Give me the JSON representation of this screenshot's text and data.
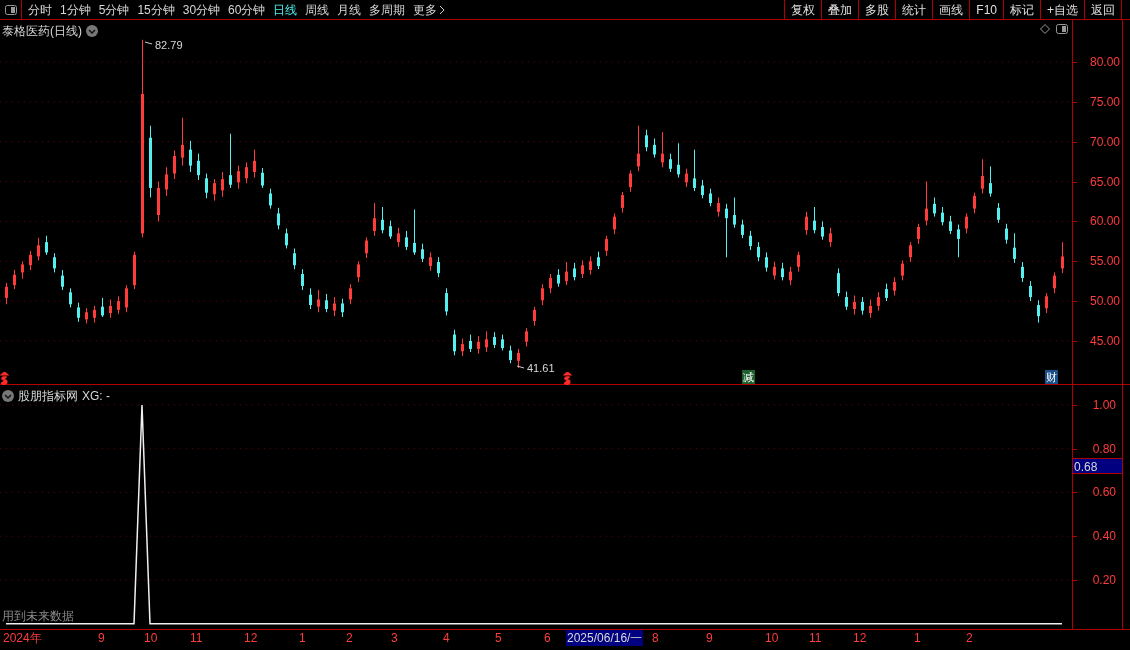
{
  "toolbar": {
    "periods": [
      {
        "label": "分时",
        "selected": false
      },
      {
        "label": "1分钟",
        "selected": false
      },
      {
        "label": "5分钟",
        "selected": false
      },
      {
        "label": "15分钟",
        "selected": false
      },
      {
        "label": "30分钟",
        "selected": false
      },
      {
        "label": "60分钟",
        "selected": false
      },
      {
        "label": "日线",
        "selected": true
      },
      {
        "label": "周线",
        "selected": false
      },
      {
        "label": "月线",
        "selected": false
      },
      {
        "label": "多周期",
        "selected": false
      },
      {
        "label": "更多",
        "selected": false
      }
    ],
    "buttons": [
      "复权",
      "叠加",
      "多股",
      "统计",
      "画线",
      "F10",
      "标记",
      "+自选",
      "返回"
    ]
  },
  "price_chart": {
    "title": "泰格医药(日线)",
    "high_label": "82.79",
    "low_label": "41.61",
    "chart_data": {
      "type": "candlestick",
      "ohlc": [
        [
          50.4,
          52.3,
          49.6,
          51.8
        ],
        [
          52.0,
          53.9,
          51.5,
          53.3
        ],
        [
          53.6,
          55.0,
          52.8,
          54.6
        ],
        [
          54.5,
          56.3,
          53.9,
          55.8
        ],
        [
          55.6,
          57.9,
          55.1,
          57.0
        ],
        [
          57.4,
          58.2,
          55.8,
          56.1
        ],
        [
          55.5,
          56.0,
          53.6,
          54.1
        ],
        [
          53.2,
          53.9,
          51.4,
          51.8
        ],
        [
          51.1,
          51.6,
          49.2,
          49.6
        ],
        [
          49.2,
          49.8,
          47.4,
          47.9
        ],
        [
          47.7,
          49.1,
          47.2,
          48.6
        ],
        [
          47.9,
          49.4,
          47.3,
          48.9
        ],
        [
          49.3,
          50.4,
          48.0,
          48.2
        ],
        [
          48.5,
          50.2,
          47.9,
          49.4
        ],
        [
          48.9,
          50.6,
          48.4,
          50.0
        ],
        [
          49.2,
          52.0,
          48.6,
          51.6
        ],
        [
          52.0,
          56.2,
          51.5,
          55.8
        ],
        [
          58.5,
          82.79,
          58.0,
          76.0
        ],
        [
          70.5,
          72.0,
          63.0,
          64.2
        ],
        [
          60.8,
          65.0,
          60.0,
          64.2
        ],
        [
          64.0,
          66.8,
          63.2,
          65.9
        ],
        [
          66.0,
          68.9,
          65.3,
          68.2
        ],
        [
          68.0,
          73.0,
          67.0,
          69.6
        ],
        [
          69.0,
          70.1,
          66.2,
          67.0
        ],
        [
          67.6,
          68.5,
          65.2,
          65.8
        ],
        [
          65.4,
          66.0,
          62.9,
          63.6
        ],
        [
          63.4,
          65.3,
          62.6,
          64.8
        ],
        [
          63.9,
          66.2,
          63.1,
          65.3
        ],
        [
          65.8,
          71.0,
          64.2,
          64.6
        ],
        [
          64.9,
          67.0,
          64.1,
          66.3
        ],
        [
          65.4,
          67.4,
          64.8,
          66.8
        ],
        [
          66.2,
          69.0,
          65.5,
          67.6
        ],
        [
          66.1,
          66.7,
          64.2,
          64.5
        ],
        [
          63.5,
          64.1,
          61.6,
          62.0
        ],
        [
          61.0,
          61.7,
          59.0,
          59.5
        ],
        [
          58.5,
          59.1,
          56.6,
          57.0
        ],
        [
          56.0,
          56.6,
          54.0,
          54.5
        ],
        [
          53.4,
          54.0,
          51.4,
          51.9
        ],
        [
          50.8,
          51.6,
          49.0,
          49.5
        ],
        [
          49.3,
          51.4,
          48.6,
          50.2
        ],
        [
          50.1,
          50.9,
          48.6,
          49.0
        ],
        [
          48.8,
          50.5,
          48.1,
          49.7
        ],
        [
          49.7,
          50.3,
          48.0,
          48.6
        ],
        [
          50.2,
          52.1,
          49.6,
          51.6
        ],
        [
          53.0,
          55.0,
          52.4,
          54.6
        ],
        [
          56.0,
          58.0,
          55.4,
          57.6
        ],
        [
          58.8,
          62.3,
          58.2,
          60.4
        ],
        [
          60.2,
          61.8,
          58.5,
          58.9
        ],
        [
          59.4,
          60.1,
          57.8,
          58.1
        ],
        [
          57.4,
          59.2,
          56.8,
          58.5
        ],
        [
          58.0,
          58.8,
          56.4,
          56.8
        ],
        [
          57.3,
          61.5,
          55.8,
          56.1
        ],
        [
          56.5,
          57.2,
          54.9,
          55.3
        ],
        [
          54.4,
          56.1,
          53.8,
          55.5
        ],
        [
          54.9,
          55.5,
          53.0,
          53.5
        ],
        [
          51.0,
          51.6,
          48.2,
          48.7
        ],
        [
          45.8,
          46.4,
          43.2,
          43.7
        ],
        [
          43.7,
          45.3,
          43.1,
          44.6
        ],
        [
          45.0,
          45.8,
          43.6,
          44.0
        ],
        [
          44.0,
          45.6,
          43.4,
          44.9
        ],
        [
          44.2,
          46.2,
          43.6,
          45.2
        ],
        [
          45.5,
          46.1,
          44.1,
          44.5
        ],
        [
          45.2,
          45.8,
          43.8,
          44.1
        ],
        [
          43.8,
          44.4,
          42.2,
          42.6
        ],
        [
          42.5,
          44.0,
          41.61,
          43.5
        ],
        [
          44.9,
          46.6,
          44.3,
          46.2
        ],
        [
          47.5,
          49.3,
          46.9,
          48.9
        ],
        [
          50.1,
          52.1,
          49.5,
          51.6
        ],
        [
          51.6,
          53.4,
          51.0,
          52.9
        ],
        [
          53.3,
          54.0,
          51.8,
          52.2
        ],
        [
          52.5,
          54.9,
          52.0,
          53.7
        ],
        [
          54.1,
          54.8,
          52.6,
          53.0
        ],
        [
          53.4,
          55.1,
          52.9,
          54.5
        ],
        [
          53.9,
          55.6,
          53.3,
          55.0
        ],
        [
          55.5,
          56.2,
          54.0,
          54.4
        ],
        [
          56.3,
          58.2,
          55.7,
          57.8
        ],
        [
          59.0,
          61.0,
          58.4,
          60.6
        ],
        [
          61.7,
          63.7,
          61.1,
          63.3
        ],
        [
          64.3,
          66.4,
          63.7,
          66.0
        ],
        [
          66.9,
          72.0,
          66.3,
          68.5
        ],
        [
          70.8,
          71.5,
          68.8,
          69.3
        ],
        [
          69.6,
          70.4,
          68.0,
          68.4
        ],
        [
          67.4,
          71.2,
          66.8,
          68.5
        ],
        [
          67.8,
          68.5,
          66.2,
          66.6
        ],
        [
          67.1,
          69.8,
          65.5,
          65.9
        ],
        [
          64.9,
          66.6,
          64.3,
          66.0
        ],
        [
          65.4,
          69.0,
          63.8,
          64.2
        ],
        [
          64.5,
          65.2,
          62.9,
          63.3
        ],
        [
          63.5,
          64.1,
          61.9,
          62.3
        ],
        [
          61.2,
          63.0,
          60.6,
          62.3
        ],
        [
          61.6,
          62.2,
          55.5,
          60.4
        ],
        [
          60.8,
          63.0,
          59.2,
          59.6
        ],
        [
          59.6,
          60.2,
          57.9,
          58.3
        ],
        [
          58.2,
          58.8,
          56.4,
          56.9
        ],
        [
          56.8,
          57.4,
          55.0,
          55.5
        ],
        [
          55.5,
          56.1,
          53.7,
          54.2
        ],
        [
          53.2,
          54.9,
          52.7,
          54.3
        ],
        [
          54.1,
          54.8,
          52.6,
          53.0
        ],
        [
          52.6,
          54.3,
          52.0,
          53.7
        ],
        [
          54.3,
          56.2,
          53.7,
          55.8
        ],
        [
          58.9,
          61.2,
          58.3,
          60.6
        ],
        [
          60.1,
          61.8,
          58.5,
          58.9
        ],
        [
          59.3,
          60.0,
          57.7,
          58.1
        ],
        [
          57.4,
          59.2,
          56.8,
          58.5
        ],
        [
          53.5,
          54.1,
          50.6,
          51.0
        ],
        [
          50.5,
          51.2,
          48.9,
          49.3
        ],
        [
          49.0,
          50.7,
          48.3,
          49.9
        ],
        [
          49.9,
          50.5,
          48.3,
          48.8
        ],
        [
          48.5,
          50.2,
          47.9,
          49.4
        ],
        [
          49.4,
          51.1,
          48.8,
          50.5
        ],
        [
          51.5,
          52.2,
          50.0,
          50.4
        ],
        [
          51.3,
          53.0,
          50.7,
          52.4
        ],
        [
          53.2,
          55.1,
          52.6,
          54.7
        ],
        [
          55.5,
          57.4,
          54.9,
          57.0
        ],
        [
          57.8,
          59.7,
          57.2,
          59.3
        ],
        [
          60.1,
          65.0,
          59.5,
          61.6
        ],
        [
          62.2,
          63.0,
          60.6,
          61.0
        ],
        [
          61.1,
          61.8,
          59.5,
          59.9
        ],
        [
          60.0,
          60.7,
          58.4,
          58.8
        ],
        [
          59.0,
          59.6,
          55.5,
          57.8
        ],
        [
          59.1,
          61.0,
          58.5,
          60.6
        ],
        [
          61.6,
          63.6,
          61.0,
          63.2
        ],
        [
          64.1,
          67.8,
          63.5,
          65.7
        ],
        [
          64.8,
          66.9,
          63.1,
          63.5
        ],
        [
          61.7,
          62.3,
          59.8,
          60.2
        ],
        [
          59.1,
          59.7,
          57.2,
          57.7
        ],
        [
          56.7,
          58.5,
          54.8,
          55.3
        ],
        [
          54.3,
          54.9,
          52.4,
          52.9
        ],
        [
          51.9,
          52.5,
          50.0,
          50.5
        ],
        [
          49.5,
          50.1,
          47.3,
          48.1
        ],
        [
          49.1,
          51.0,
          48.5,
          50.6
        ],
        [
          51.6,
          53.6,
          51.0,
          53.2
        ],
        [
          54.1,
          57.4,
          53.5,
          55.6
        ]
      ],
      "ylim": [
        39.47,
        85.27
      ],
      "grid": true,
      "yticks": [
        {
          "value": 80,
          "label": "80.00"
        },
        {
          "value": 75,
          "label": "75.00"
        },
        {
          "value": 70,
          "label": "70.00"
        },
        {
          "value": 65,
          "label": "65.00"
        },
        {
          "value": 60,
          "label": "60.00"
        },
        {
          "value": 55,
          "label": "55.00"
        },
        {
          "value": 50,
          "label": "50.00"
        },
        {
          "value": 45,
          "label": "45.00"
        }
      ]
    },
    "event_badges": [
      {
        "label": "减",
        "color": "#1d5f2e"
      },
      {
        "label": "财",
        "color": "#1b4f8a"
      }
    ]
  },
  "indicator": {
    "title": "股朋指标网",
    "value_label": "XG: -",
    "chart_data": {
      "type": "line",
      "ylim": [
        -0.024,
        1.091
      ],
      "grid": true,
      "yticks": [
        {
          "value": 1,
          "label": "1.00"
        },
        {
          "value": 0.8,
          "label": "0.80"
        },
        {
          "value": 0.6,
          "label": "0.60"
        },
        {
          "value": 0.4,
          "label": "0.40"
        },
        {
          "value": 0.2,
          "label": "0.20"
        }
      ],
      "series": [
        {
          "values": [
            0,
            0,
            0,
            0,
            0,
            0,
            0,
            0,
            0,
            0,
            0,
            0,
            0,
            0,
            0,
            0,
            0,
            1,
            0,
            0,
            0,
            0,
            0,
            0,
            0,
            0,
            0,
            0,
            0,
            0,
            0,
            0,
            0,
            0,
            0,
            0,
            0,
            0,
            0,
            0,
            0,
            0,
            0,
            0,
            0,
            0,
            0,
            0,
            0,
            0,
            0,
            0,
            0,
            0,
            0,
            0,
            0,
            0,
            0,
            0,
            0,
            0,
            0,
            0,
            0,
            0,
            0,
            0,
            0,
            0,
            0,
            0,
            0,
            0,
            0,
            0,
            0,
            0,
            0,
            0,
            0,
            0,
            0,
            0,
            0,
            0,
            0,
            0,
            0,
            0,
            0,
            0,
            0,
            0,
            0,
            0,
            0,
            0,
            0,
            0,
            0,
            0,
            0,
            0,
            0,
            0,
            0,
            0,
            0,
            0,
            0,
            0,
            0,
            0,
            0,
            0,
            0,
            0,
            0,
            0,
            0,
            0,
            0,
            0,
            0,
            0,
            0,
            0,
            0,
            0,
            0,
            0,
            0
          ]
        }
      ]
    },
    "current_value": "0.68",
    "warning": "用到未来数据"
  },
  "time_axis": {
    "labels": [
      {
        "label": "2024年",
        "selected": false
      },
      {
        "label": "9",
        "selected": false
      },
      {
        "label": "10",
        "selected": false
      },
      {
        "label": "11",
        "selected": false
      },
      {
        "label": "12",
        "selected": false
      },
      {
        "label": "1",
        "selected": false
      },
      {
        "label": "2",
        "selected": false
      },
      {
        "label": "3",
        "selected": false
      },
      {
        "label": "4",
        "selected": false
      },
      {
        "label": "5",
        "selected": false
      },
      {
        "label": "6",
        "selected": false
      },
      {
        "label": "2025/06/16/一",
        "selected": true
      },
      {
        "label": "8",
        "selected": false
      },
      {
        "label": "9",
        "selected": false
      },
      {
        "label": "10",
        "selected": false
      },
      {
        "label": "11",
        "selected": false
      },
      {
        "label": "12",
        "selected": false
      },
      {
        "label": "1",
        "selected": false
      },
      {
        "label": "2",
        "selected": false
      }
    ]
  }
}
